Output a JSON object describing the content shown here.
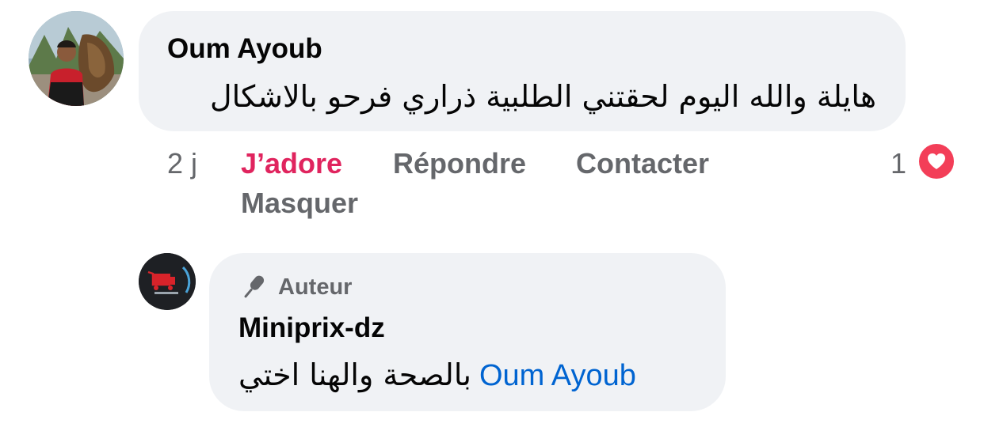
{
  "comment": {
    "author": "Oum Ayoub",
    "text": "هايلة والله اليوم لحقتني الطلبية ذراري فرحو بالاشكال",
    "time": "2 j",
    "actions": {
      "love": "J’adore",
      "reply": "Répondre",
      "contact": "Contacter",
      "hide": "Masquer"
    },
    "reaction_count": "1",
    "reaction_icon": "heart-icon",
    "reaction_color": "#f33e58",
    "love_color": "#e0245e"
  },
  "reply": {
    "badge_icon": "microphone-icon",
    "badge_label": "Auteur",
    "author": "Miniprix-dz",
    "mention": "Oum Ayoub",
    "text": "بالصحة والهنا اختي",
    "mention_color": "#0064d1"
  },
  "colors": {
    "bubble": "#f0f2f5",
    "secondary_text": "#65676b",
    "primary_text": "#050505"
  }
}
